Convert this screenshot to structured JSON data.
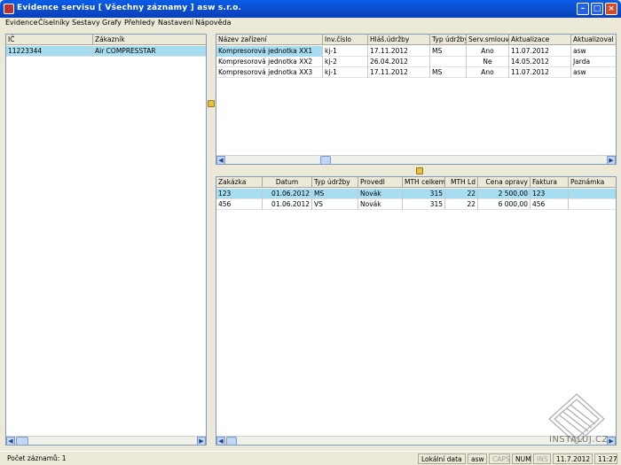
{
  "window": {
    "title": "Evidence servisu [ Všechny záznamy ]   asw s.r.o."
  },
  "menu": [
    "Evidence",
    "Číselníky",
    "Sestavy",
    "Grafy",
    "Přehledy",
    "Nastavení",
    "Nápověda"
  ],
  "left_grid": {
    "columns": [
      "IČ",
      "Zákazník"
    ],
    "rows": [
      {
        "ic": "11223344",
        "zakaznik": "Air COMPRESSTAR"
      }
    ]
  },
  "top_grid": {
    "columns": [
      "Název zařízení",
      "Inv.číslo",
      "Hláš.údržby",
      "Typ údržby",
      "Serv.smlouva",
      "Aktualizace",
      "Aktualizoval"
    ],
    "rows": [
      [
        "Kompresorová jednotka XX1",
        "kj-1",
        "17.11.2012",
        "MS",
        "Ano",
        "11.07.2012",
        "asw"
      ],
      [
        "Kompresorová jednotka XX2",
        "kj-2",
        "26.04.2012",
        "",
        "Ne",
        "14.05.2012",
        "Jarda"
      ],
      [
        "Kompresorová jednotka XX3",
        "kj-1",
        "17.11.2012",
        "MS",
        "Ano",
        "11.07.2012",
        "asw"
      ]
    ]
  },
  "bottom_grid": {
    "columns": [
      "Zakázka",
      "Datum",
      "Typ údržby",
      "Provedl",
      "MTH celkem",
      "MTH Ld",
      "Cena opravy",
      "Faktura",
      "Poznámka"
    ],
    "rows": [
      [
        "123",
        "01.06.2012",
        "MS",
        "Novák",
        "315",
        "22",
        "2 500,00",
        "123",
        ""
      ],
      [
        "456",
        "01.06.2012",
        "VS",
        "Novák",
        "315",
        "22",
        "6 000,00",
        "456",
        ""
      ]
    ]
  },
  "status": {
    "records": "Počet záznamů: 1",
    "source": "Lokální data",
    "user": "asw",
    "caps": "CAPS",
    "num": "NUM",
    "ins": "INS",
    "date": "11.7.2012",
    "time": "11:27"
  },
  "watermark_text": "INSTALUJ.CZ",
  "colors": {
    "selection": "#a6ddf0",
    "title_bar": "#0a5de6",
    "close_button": "#d8492c"
  }
}
